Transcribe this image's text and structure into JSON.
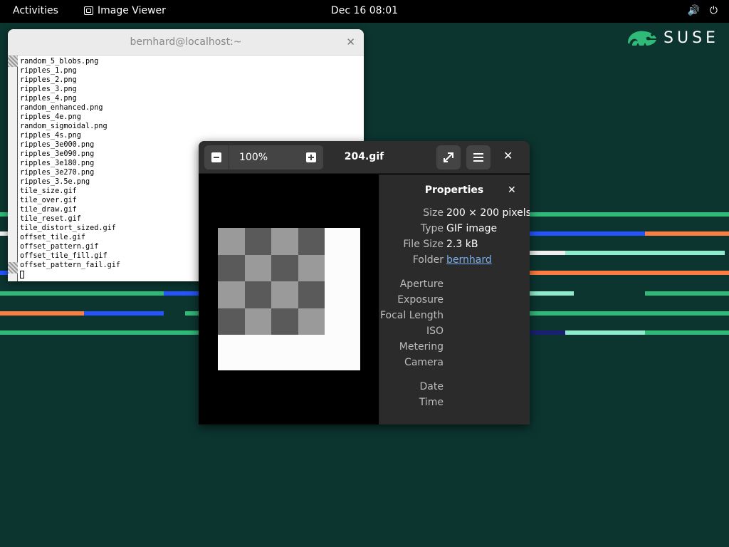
{
  "topbar": {
    "activities": "Activities",
    "app_name": "Image Viewer",
    "clock": "Dec 16  08:01",
    "volume_icon": "🔊",
    "power_icon": "⏻"
  },
  "wallpaper": {
    "brand": "SUSE",
    "colors": {
      "green": "#30ba78",
      "blue": "#2453ff",
      "orange": "#fe7c3f",
      "mint": "#90ebcd",
      "navy": "#192072"
    }
  },
  "terminal": {
    "title": "bernhard@localhost:~",
    "close_glyph": "✕",
    "lines": [
      "random_5_blobs.png",
      "ripples_1.png",
      "ripples_2.png",
      "ripples_3.png",
      "ripples_4.png",
      "random_enhanced.png",
      "ripples_4e.png",
      "random_sigmoidal.png",
      "ripples_4s.png",
      "ripples_3e000.png",
      "ripples_3e090.png",
      "ripples_3e180.png",
      "ripples_3e270.png",
      "ripples_3.5e.png",
      "tile_size.gif",
      "tile_over.gif",
      "tile_draw.gif",
      "tile_reset.gif",
      "tile_distort_sized.gif",
      "offset_tile.gif",
      "offset_pattern.gif",
      "offset_tile_fill.gif",
      "offset_pattern_fail.gif"
    ]
  },
  "viewer": {
    "zoom": "100%",
    "file_name": "204.gif",
    "close_glyph": "✕",
    "properties": {
      "title": "Properties",
      "close_glyph": "✕",
      "rows": [
        {
          "label": "Size",
          "value": "200 × 200 pixels"
        },
        {
          "label": "Type",
          "value": "GIF image"
        },
        {
          "label": "File Size",
          "value": "2.3 kB"
        },
        {
          "label": "Folder",
          "value": "bernhard"
        },
        {
          "label": "Aperture",
          "value": ""
        },
        {
          "label": "Exposure",
          "value": ""
        },
        {
          "label": "Focal Length",
          "value": ""
        },
        {
          "label": "ISO",
          "value": ""
        },
        {
          "label": "Metering",
          "value": ""
        },
        {
          "label": "Camera",
          "value": ""
        },
        {
          "label": "Date",
          "value": ""
        },
        {
          "label": "Time",
          "value": ""
        }
      ]
    }
  }
}
